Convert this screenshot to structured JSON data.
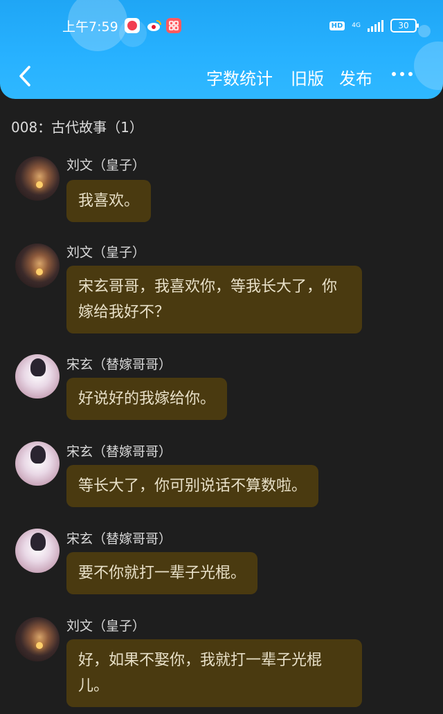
{
  "status_bar": {
    "time": "上午7:59",
    "hd": "HD",
    "network": "4G",
    "battery": "30"
  },
  "nav": {
    "back_icon": "chevron-left-icon",
    "word_count": "字数统计",
    "old_version": "旧版",
    "publish": "发布",
    "more_icon": "more-dots-icon"
  },
  "chapter": {
    "title": "008：古代故事（1）"
  },
  "colors": {
    "header": "#27b1ff",
    "background": "#1e1e1e",
    "bubble": "#4a3a10"
  },
  "messages": [
    {
      "speaker": "刘文（皇子）",
      "text": "我喜欢。"
    },
    {
      "speaker": "刘文（皇子）",
      "text": "宋玄哥哥，我喜欢你，等我长大了，你嫁给我好不？"
    },
    {
      "speaker": "宋玄（替嫁哥哥）",
      "text": "好说好的我嫁给你。"
    },
    {
      "speaker": "宋玄（替嫁哥哥）",
      "text": "等长大了，你可别说话不算数啦。"
    },
    {
      "speaker": "宋玄（替嫁哥哥）",
      "text": "要不你就打一辈子光棍。"
    },
    {
      "speaker": "刘文（皇子）",
      "text": "好，如果不娶你，我就打一辈子光棍儿。"
    }
  ]
}
